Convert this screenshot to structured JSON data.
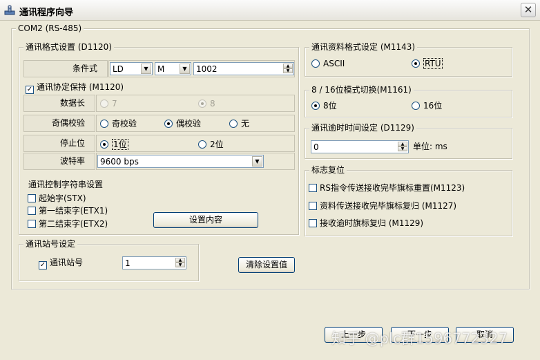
{
  "window": {
    "title": "通讯程序向导"
  },
  "com_group": {
    "title": "COM2 (RS-485)"
  },
  "comm_format": {
    "title": "通讯格式设置 (D1120)",
    "condition": {
      "label": "条件式",
      "combo1": "LD",
      "combo2": "M",
      "value": "1002"
    },
    "protocol_hold": {
      "label": "通讯协定保持 (M1120)",
      "checked": true
    },
    "data_length": {
      "label": "数据长",
      "options": [
        "7",
        "8"
      ],
      "selected": "8"
    },
    "parity": {
      "label": "奇偶校验",
      "options": [
        "奇校验",
        "偶校验",
        "无"
      ],
      "selected": "偶校验"
    },
    "stop_bit": {
      "label": "停止位",
      "options": [
        "1位",
        "2位"
      ],
      "selected": "1位"
    },
    "baud": {
      "label": "波特率",
      "value": "9600 bps"
    },
    "control_chars": {
      "title": "通讯控制字符串设置",
      "items": [
        "起始字(STX)",
        "第一结束字(ETX1)",
        "第二结束字(ETX2)"
      ],
      "button": "设置内容"
    }
  },
  "data_format": {
    "title": "通讯资料格式设定 (M1143)",
    "options": [
      "ASCII",
      "RTU"
    ],
    "selected": "RTU"
  },
  "bit_mode": {
    "title": "8 / 16位模式切换(M1161)",
    "options": [
      "8位",
      "16位"
    ],
    "selected": "8位"
  },
  "timeout": {
    "title": "通讯逾时时间设定 (D1129)",
    "value": "0",
    "unit_label": "单位: ms"
  },
  "flag_reset": {
    "title": "标志复位",
    "items": [
      "RS指令传送接收完毕旗标重置(M1123)",
      "资料传送接收完毕旗标复归 (M1127)",
      "接收逾时旗标复归 (M1129)"
    ]
  },
  "station": {
    "title": "通讯站号设定",
    "checkbox_label": "通讯站号",
    "checked": true,
    "value": "1"
  },
  "clear_button": "清除设置值",
  "footer": {
    "prev": "上一步",
    "next": "下一步",
    "cancel": "取消"
  },
  "watermark": "知乎 @plc群1596772327"
}
